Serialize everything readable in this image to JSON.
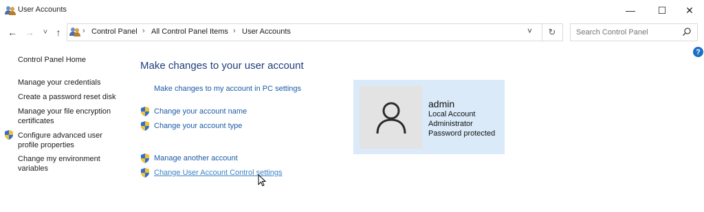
{
  "window": {
    "title": "User Accounts",
    "icon": "users-icon",
    "controls": {
      "minimize": "—",
      "maximize": "☐",
      "close": "✕"
    }
  },
  "nav": {
    "back": "←",
    "forward": "→",
    "recent": "˅",
    "up": "↑",
    "breadcrumb": [
      "Control Panel",
      "All Control Panel Items",
      "User Accounts"
    ],
    "dropdown": "˅",
    "refresh": "↻",
    "search_placeholder": "Search Control Panel",
    "help": "?"
  },
  "sidebar": {
    "home": "Control Panel Home",
    "items": [
      {
        "label": "Manage your credentials",
        "shield": false
      },
      {
        "label": "Create a password reset disk",
        "shield": false
      },
      {
        "label": "Manage your file encryption certificates",
        "shield": false
      },
      {
        "label": "Configure advanced user profile properties",
        "shield": true
      },
      {
        "label": "Change my environment variables",
        "shield": false
      }
    ]
  },
  "main": {
    "heading": "Make changes to your user account",
    "pc_settings_link": "Make changes to my account in PC settings",
    "change_name": "Change your account name",
    "change_type": "Change your account type",
    "manage_another": "Manage another account",
    "uac_settings": "Change User Account Control settings"
  },
  "account": {
    "name": "admin",
    "type": "Local Account",
    "role": "Administrator",
    "password": "Password protected"
  },
  "colors": {
    "link": "#1a5aa6",
    "heading": "#1e3d7b",
    "card": "#daeaf8"
  }
}
